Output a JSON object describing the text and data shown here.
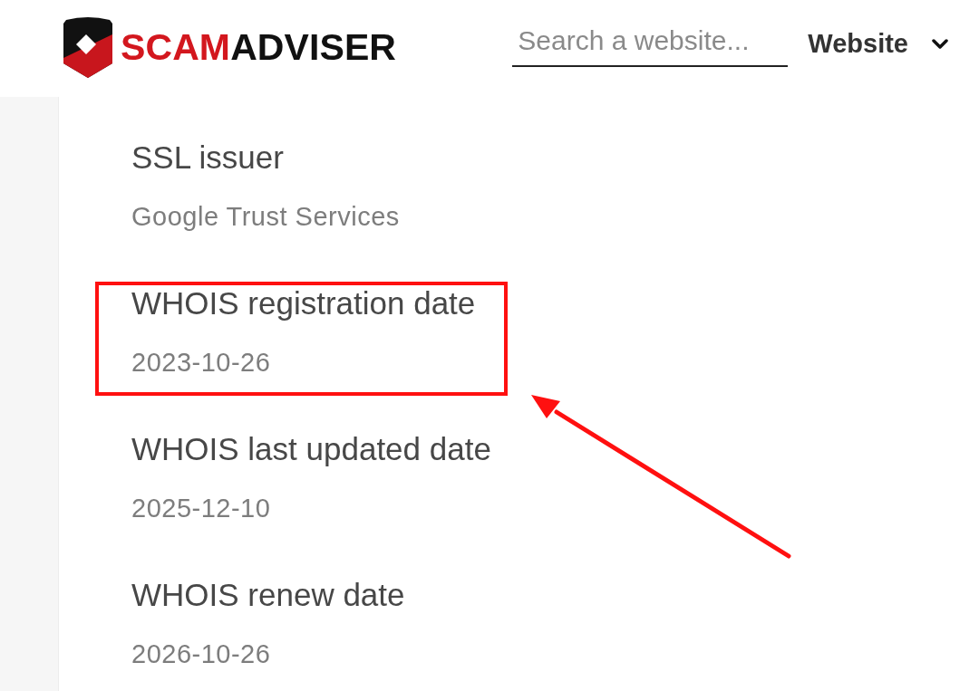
{
  "header": {
    "logo": {
      "accent": "SCAM",
      "rest": "ADVISER"
    },
    "search": {
      "placeholder": "Search a website...",
      "scope": "Website"
    }
  },
  "details": [
    {
      "label": "SSL issuer",
      "value": "Google Trust Services",
      "highlighted": false
    },
    {
      "label": "WHOIS registration date",
      "value": "2023-10-26",
      "highlighted": true
    },
    {
      "label": "WHOIS last updated date",
      "value": "2025-12-10",
      "highlighted": false
    },
    {
      "label": "WHOIS renew date",
      "value": "2026-10-26",
      "highlighted": false
    }
  ]
}
